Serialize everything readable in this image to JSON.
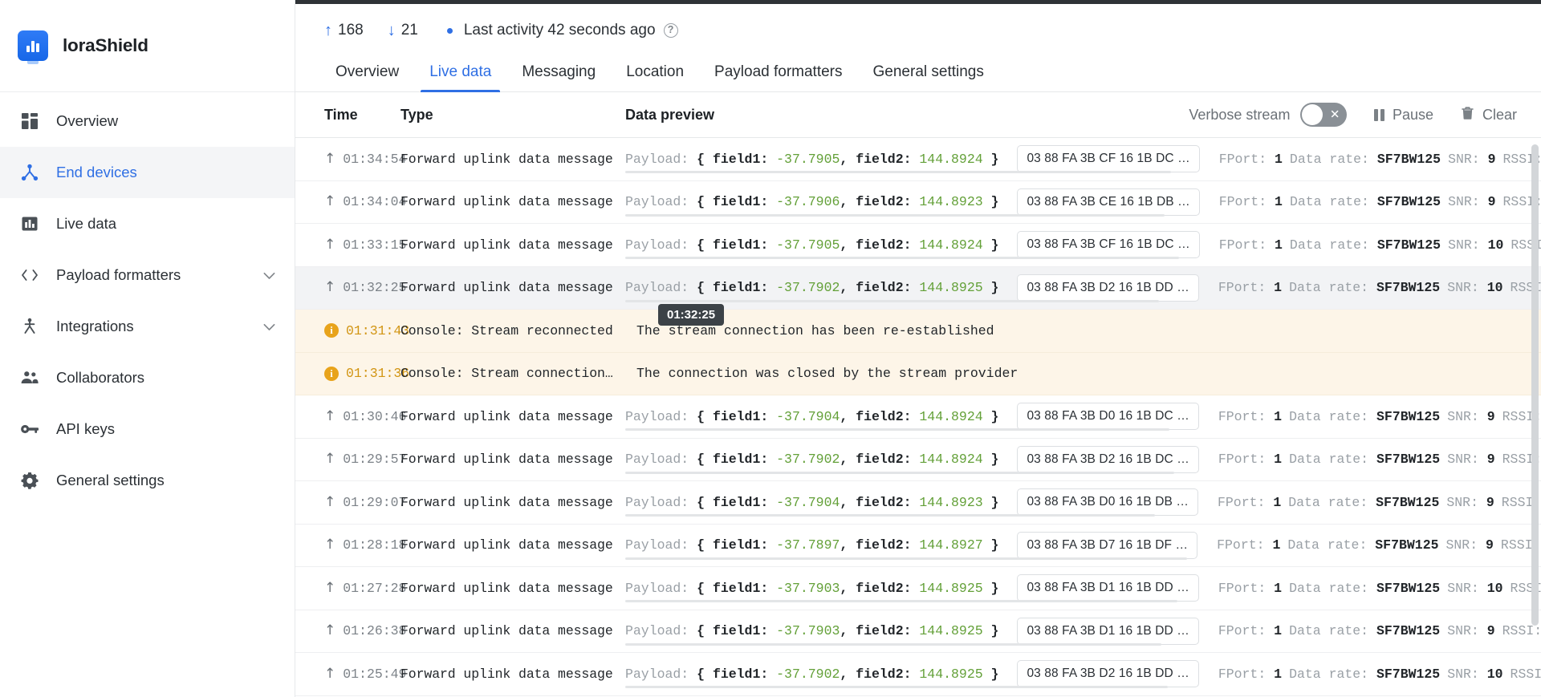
{
  "sidebar": {
    "brand": "loraShield",
    "items": [
      {
        "label": "Overview",
        "icon": "grid-icon",
        "active": false,
        "chevron": false
      },
      {
        "label": "End devices",
        "icon": "device-nodes-icon",
        "active": true,
        "chevron": false
      },
      {
        "label": "Live data",
        "icon": "bar-chart-icon",
        "active": false,
        "chevron": false
      },
      {
        "label": "Payload formatters",
        "icon": "code-brackets-icon",
        "active": false,
        "chevron": true
      },
      {
        "label": "Integrations",
        "icon": "integration-icon",
        "active": false,
        "chevron": true
      },
      {
        "label": "Collaborators",
        "icon": "people-icon",
        "active": false,
        "chevron": false
      },
      {
        "label": "API keys",
        "icon": "key-icon",
        "active": false,
        "chevron": false
      },
      {
        "label": "General settings",
        "icon": "gear-icon",
        "active": false,
        "chevron": false
      }
    ]
  },
  "header": {
    "uplink_count": "168",
    "downlink_count": "21",
    "last_activity": "Last activity 42 seconds ago",
    "help_icon": "question-mark-icon",
    "tabs": [
      {
        "label": "Overview",
        "active": false
      },
      {
        "label": "Live data",
        "active": true
      },
      {
        "label": "Messaging",
        "active": false
      },
      {
        "label": "Location",
        "active": false
      },
      {
        "label": "Payload formatters",
        "active": false
      },
      {
        "label": "General settings",
        "active": false
      }
    ]
  },
  "table": {
    "columns": {
      "time": "Time",
      "type": "Type",
      "data": "Data preview"
    },
    "tools": {
      "verbose_label": "Verbose stream",
      "verbose_on": false,
      "toggle_icon": "x-icon",
      "pause_label": "Pause",
      "pause_icon": "pause-icon",
      "clear_label": "Clear",
      "clear_icon": "trash-icon"
    }
  },
  "tooltip": {
    "text": "01:32:25"
  },
  "colors": {
    "accent": "#2f6fe4",
    "value_green": "#63a038",
    "warn_amber": "#e8a31b",
    "warn_row_bg": "#fdf5e8",
    "hover_row_bg": "#f2f3f5"
  },
  "rows": [
    {
      "kind": "uplink",
      "icon": "up-arrow-icon",
      "time": "01:34:54",
      "type": "Forward uplink data message",
      "payload_label": "Payload:",
      "field1": "-37.7905",
      "field2": "144.8924",
      "hex": "03 88 FA 3B CF 16 1B DC …",
      "fport_label": "FPort:",
      "fport": "1",
      "rate_label": "Data rate:",
      "rate": "SF7BW125",
      "snr_label": "SNR:",
      "snr": "9",
      "rssi_label": "RSSI:"
    },
    {
      "kind": "uplink",
      "icon": "up-arrow-icon",
      "time": "01:34:04",
      "type": "Forward uplink data message",
      "payload_label": "Payload:",
      "field1": "-37.7906",
      "field2": "144.8923",
      "hex": "03 88 FA 3B CE 16 1B DB …",
      "fport_label": "FPort:",
      "fport": "1",
      "rate_label": "Data rate:",
      "rate": "SF7BW125",
      "snr_label": "SNR:",
      "snr": "9",
      "rssi_label": "RSSI:"
    },
    {
      "kind": "uplink",
      "icon": "up-arrow-icon",
      "time": "01:33:15",
      "type": "Forward uplink data message",
      "payload_label": "Payload:",
      "field1": "-37.7905",
      "field2": "144.8924",
      "hex": "03 88 FA 3B CF 16 1B DC …",
      "fport_label": "FPort:",
      "fport": "1",
      "rate_label": "Data rate:",
      "rate": "SF7BW125",
      "snr_label": "SNR:",
      "snr": "10",
      "rssi_label": "RSSI:"
    },
    {
      "kind": "uplink",
      "hovered": true,
      "icon": "up-arrow-icon",
      "time": "01:32:25",
      "type": "Forward uplink data message",
      "payload_label": "Payload:",
      "field1": "-37.7902",
      "field2": "144.8925",
      "hex": "03 88 FA 3B D2 16 1B DD …",
      "fport_label": "FPort:",
      "fport": "1",
      "rate_label": "Data rate:",
      "rate": "SF7BW125",
      "snr_label": "SNR:",
      "snr": "10",
      "rssi_label": "RSSI:"
    },
    {
      "kind": "console",
      "icon": "info-icon",
      "time": "01:31:43",
      "type": "Console: Stream reconnected",
      "message": "The stream connection has been re-established"
    },
    {
      "kind": "console",
      "icon": "info-icon",
      "time": "01:31:36",
      "type": "Console: Stream connection…",
      "message": "The connection was closed by the stream provider"
    },
    {
      "kind": "uplink",
      "icon": "up-arrow-icon",
      "time": "01:30:46",
      "type": "Forward uplink data message",
      "payload_label": "Payload:",
      "field1": "-37.7904",
      "field2": "144.8924",
      "hex": "03 88 FA 3B D0 16 1B DC …",
      "fport_label": "FPort:",
      "fport": "1",
      "rate_label": "Data rate:",
      "rate": "SF7BW125",
      "snr_label": "SNR:",
      "snr": "9",
      "rssi_label": "RSSI:"
    },
    {
      "kind": "uplink",
      "icon": "up-arrow-icon",
      "time": "01:29:57",
      "type": "Forward uplink data message",
      "payload_label": "Payload:",
      "field1": "-37.7902",
      "field2": "144.8924",
      "hex": "03 88 FA 3B D2 16 1B DC …",
      "fport_label": "FPort:",
      "fport": "1",
      "rate_label": "Data rate:",
      "rate": "SF7BW125",
      "snr_label": "SNR:",
      "snr": "9",
      "rssi_label": "RSSI:"
    },
    {
      "kind": "uplink",
      "icon": "up-arrow-icon",
      "time": "01:29:07",
      "type": "Forward uplink data message",
      "payload_label": "Payload:",
      "field1": "-37.7904",
      "field2": "144.8923",
      "hex": "03 88 FA 3B D0 16 1B DB …",
      "fport_label": "FPort:",
      "fport": "1",
      "rate_label": "Data rate:",
      "rate": "SF7BW125",
      "snr_label": "SNR:",
      "snr": "9",
      "rssi_label": "RSSI:"
    },
    {
      "kind": "uplink",
      "icon": "up-arrow-icon",
      "time": "01:28:18",
      "type": "Forward uplink data message",
      "payload_label": "Payload:",
      "field1": "-37.7897",
      "field2": "144.8927",
      "hex": "03 88 FA 3B D7 16 1B DF …",
      "fport_label": "FPort:",
      "fport": "1",
      "rate_label": "Data rate:",
      "rate": "SF7BW125",
      "snr_label": "SNR:",
      "snr": "9",
      "rssi_label": "RSSI:"
    },
    {
      "kind": "uplink",
      "icon": "up-arrow-icon",
      "time": "01:27:28",
      "type": "Forward uplink data message",
      "payload_label": "Payload:",
      "field1": "-37.7903",
      "field2": "144.8925",
      "hex": "03 88 FA 3B D1 16 1B DD …",
      "fport_label": "FPort:",
      "fport": "1",
      "rate_label": "Data rate:",
      "rate": "SF7BW125",
      "snr_label": "SNR:",
      "snr": "10",
      "rssi_label": "RSSI:"
    },
    {
      "kind": "uplink",
      "icon": "up-arrow-icon",
      "time": "01:26:38",
      "type": "Forward uplink data message",
      "payload_label": "Payload:",
      "field1": "-37.7903",
      "field2": "144.8925",
      "hex": "03 88 FA 3B D1 16 1B DD …",
      "fport_label": "FPort:",
      "fport": "1",
      "rate_label": "Data rate:",
      "rate": "SF7BW125",
      "snr_label": "SNR:",
      "snr": "9",
      "rssi_label": "RSSI:"
    },
    {
      "kind": "uplink",
      "icon": "up-arrow-icon",
      "time": "01:25:49",
      "type": "Forward uplink data message",
      "payload_label": "Payload:",
      "field1": "-37.7902",
      "field2": "144.8925",
      "hex": "03 88 FA 3B D2 16 1B DD …",
      "fport_label": "FPort:",
      "fport": "1",
      "rate_label": "Data rate:",
      "rate": "SF7BW125",
      "snr_label": "SNR:",
      "snr": "10",
      "rssi_label": "RSSI:"
    }
  ]
}
